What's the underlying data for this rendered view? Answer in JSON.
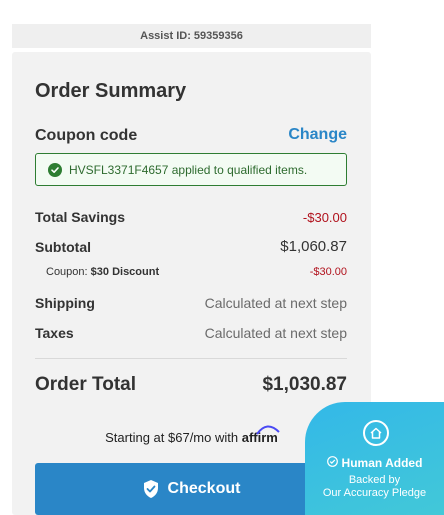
{
  "assist": {
    "label": "Assist ID: 59359356"
  },
  "summary": {
    "title": "Order Summary",
    "coupon_label": "Coupon code",
    "change_label": "Change",
    "applied_message": "HVSFL3371F4657 applied to qualified items.",
    "total_savings_label": "Total Savings",
    "total_savings_value": "-$30.00",
    "subtotal_label": "Subtotal",
    "subtotal_value": "$1,060.87",
    "coupon_line_prefix": "Coupon:",
    "coupon_line_name": "$30 Discount",
    "coupon_line_value": "-$30.00",
    "shipping_label": "Shipping",
    "shipping_value": "Calculated at next step",
    "taxes_label": "Taxes",
    "taxes_value": "Calculated at next step",
    "order_total_label": "Order Total",
    "order_total_value": "$1,030.87"
  },
  "financing": {
    "text": "Starting at $67/mo with",
    "brand": "affirm"
  },
  "checkout": {
    "label": "Checkout"
  },
  "badge": {
    "title": "Human Added",
    "line1": "Backed by",
    "line2": "Our Accuracy Pledge"
  },
  "colors": {
    "accent": "#2a86c7",
    "savings_red": "#b1121d",
    "success_green": "#2e7d32",
    "badge_teal": "#3cc0e0"
  },
  "icons": {
    "applied": "check-circle-icon",
    "checkout": "shield-check-icon",
    "badge": "home-icon",
    "badge_check": "check-circle-icon"
  }
}
